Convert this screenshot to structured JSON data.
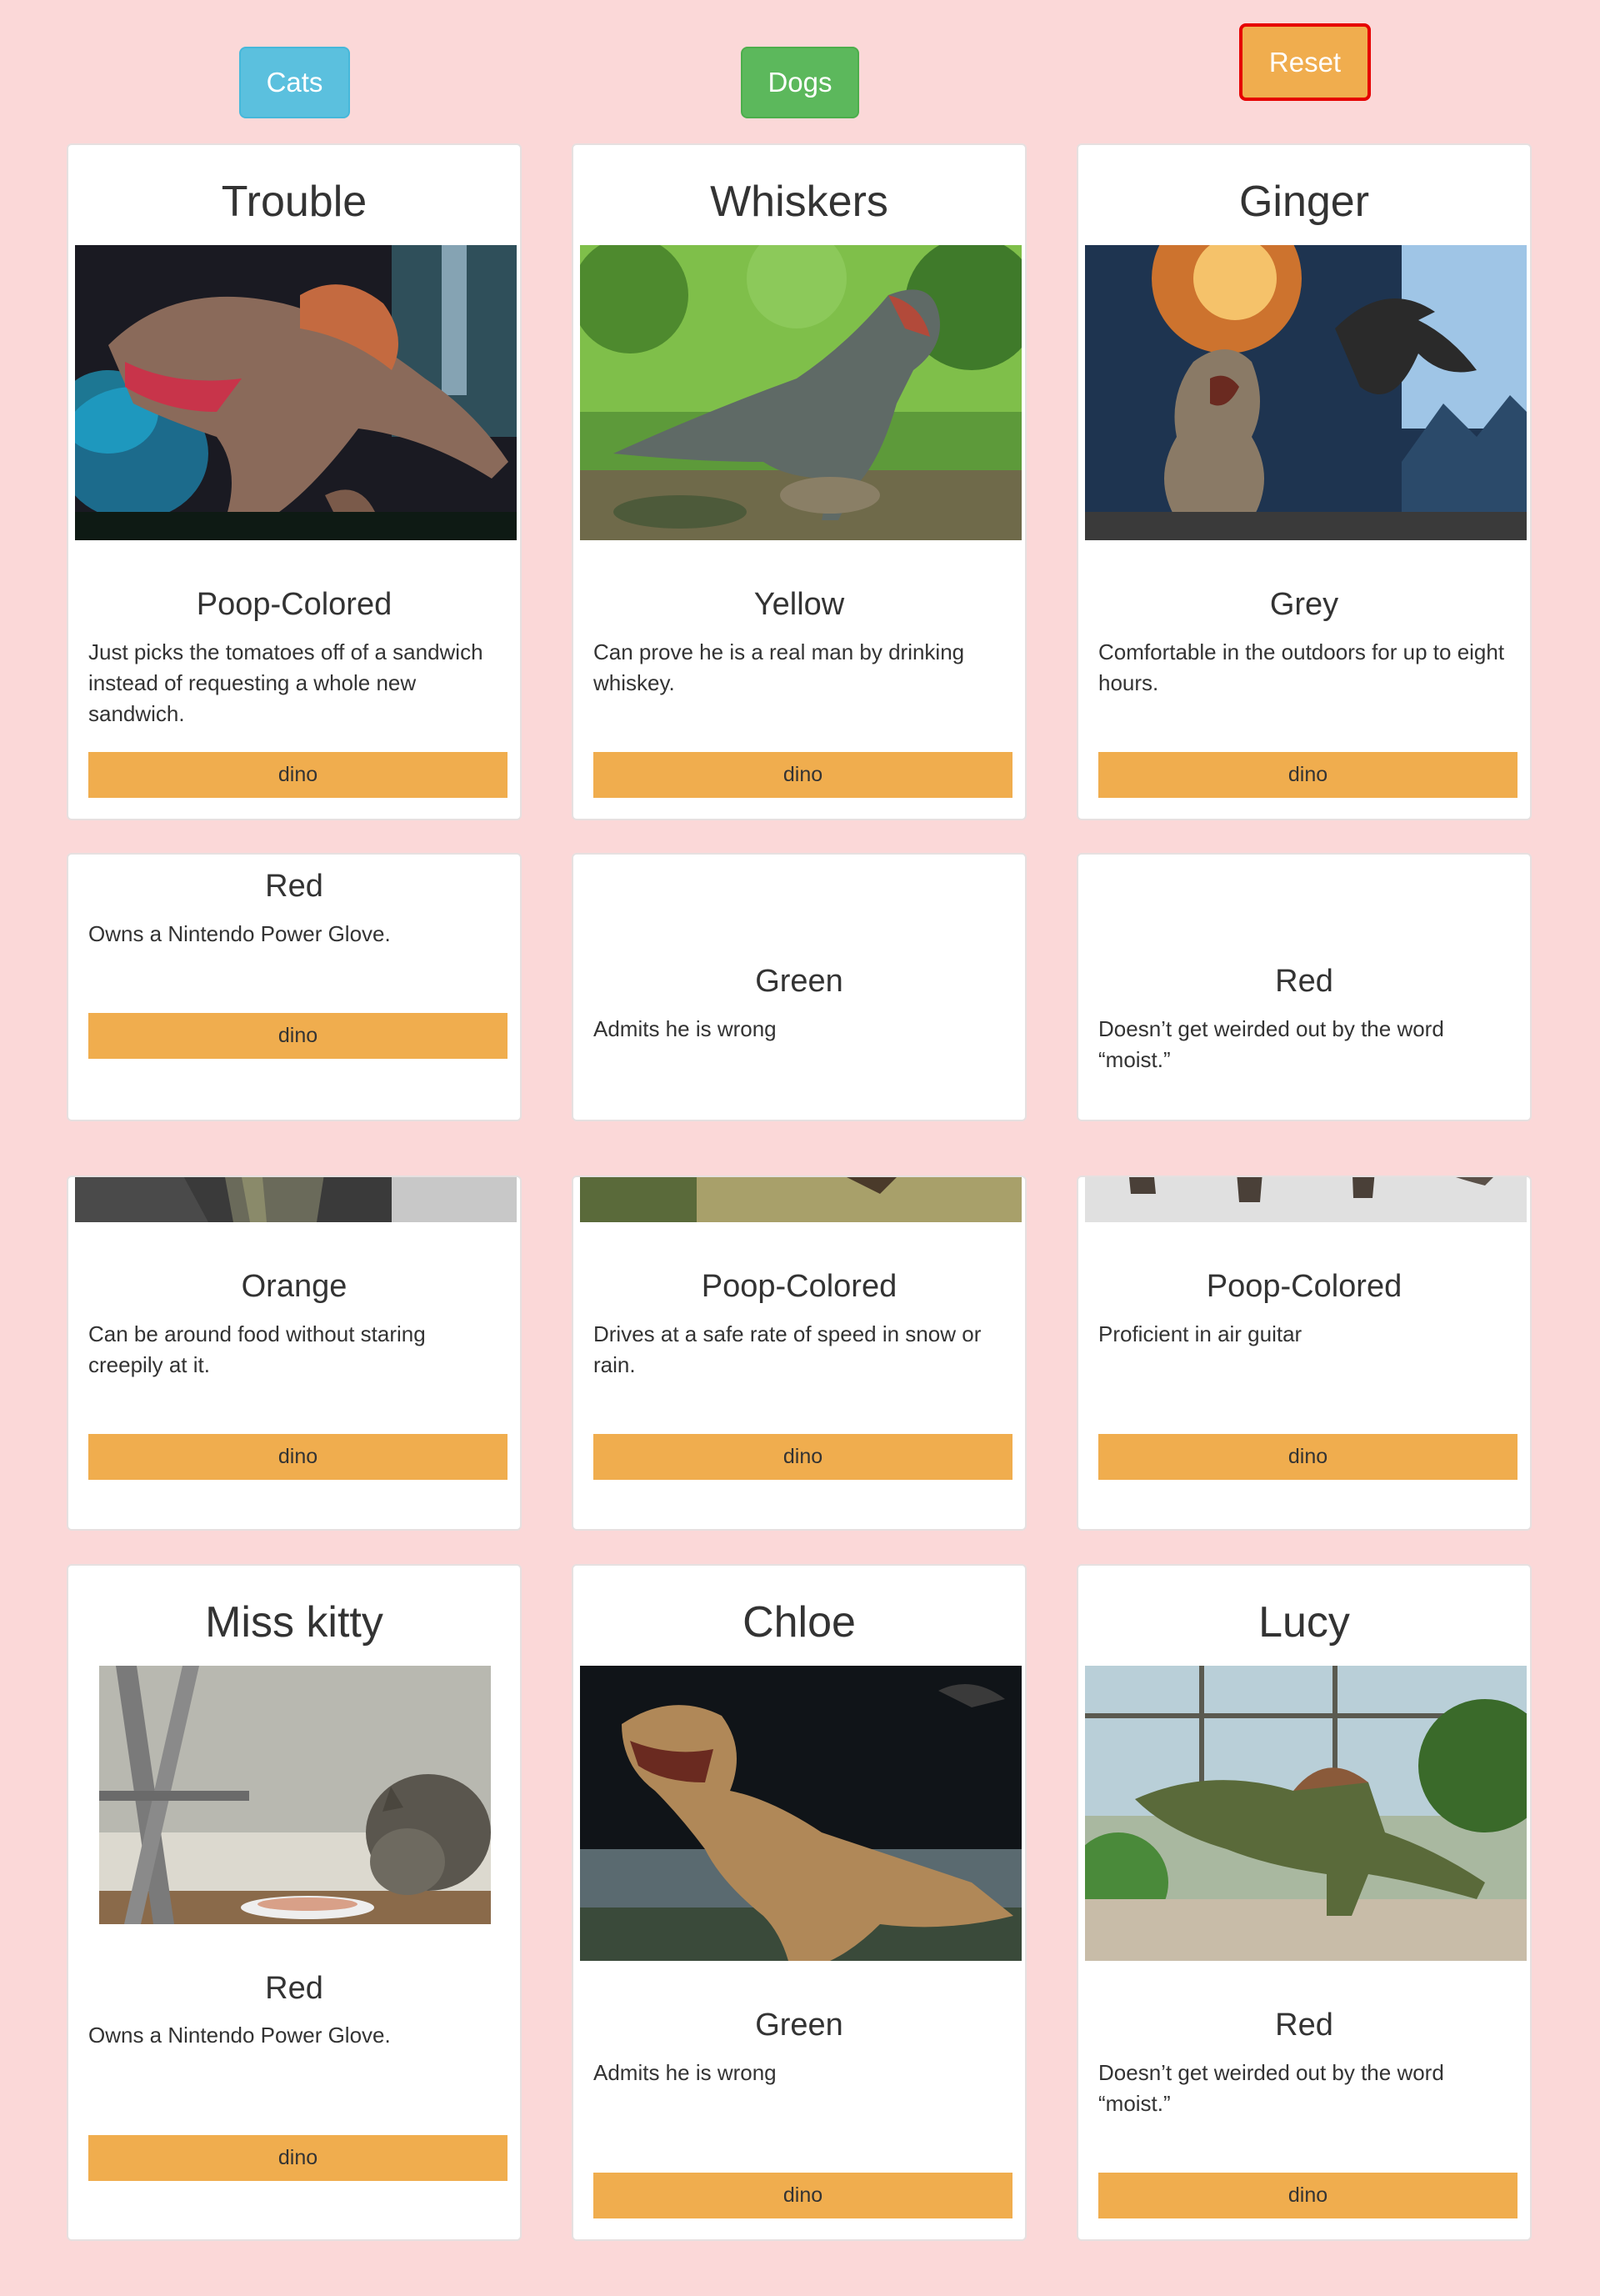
{
  "filters": {
    "cats_label": "Cats",
    "dogs_label": "Dogs",
    "reset_label": "Reset"
  },
  "colors": {
    "page_background": "#fbd8d8",
    "cats_button": "#5bc0de",
    "dogs_button": "#5cb85c",
    "reset_button": "#f0ad4e",
    "reset_border": "#e60000",
    "dino_button": "#f0ad4e"
  },
  "cards": [
    {
      "name": "Trouble",
      "color": "Poop-Colored",
      "description": "Just picks the tomatoes off of a sandwich instead of requesting a whole new sandwich.",
      "button": "dino",
      "image": "spinosaurus-photo"
    },
    {
      "name": "Whiskers",
      "color": "Yellow",
      "description": "Can prove he is a real man by drinking whiskey.",
      "button": "dino",
      "image": "t-rex-forest-photo"
    },
    {
      "name": "Ginger",
      "color": "Grey",
      "description": "Comfortable in the outdoors for up to eight hours.",
      "button": "dino",
      "image": "t-rex-pterosaur-photo"
    },
    {
      "name": "",
      "color": "Red",
      "description": "Owns a Nintendo Power Glove.",
      "button": "dino",
      "image": ""
    },
    {
      "name": "",
      "color": "Green",
      "description": "Admits he is wrong",
      "button": "dino",
      "image": ""
    },
    {
      "name": "",
      "color": "Red",
      "description": "Doesn’t get weirded out by the word “moist.”",
      "button": "dino",
      "image": ""
    },
    {
      "name": "",
      "color": "Orange",
      "description": "Can be around food without staring creepily at it.",
      "button": "dino",
      "image": "dino-rocks-photo"
    },
    {
      "name": "",
      "color": "Poop-Colored",
      "description": "Drives at a safe rate of speed in snow or rain.",
      "button": "dino",
      "image": "dino-grass-photo"
    },
    {
      "name": "",
      "color": "Poop-Colored",
      "description": "Proficient in air guitar",
      "button": "dino",
      "image": "dino-legs-photo"
    },
    {
      "name": "Miss kitty",
      "color": "Red",
      "description": "Owns a Nintendo Power Glove.",
      "button": "dino",
      "image": "cat-eating-photo"
    },
    {
      "name": "Chloe",
      "color": "Green",
      "description": "Admits he is wrong",
      "button": "dino",
      "image": "t-rex-museum-photo"
    },
    {
      "name": "Lucy",
      "color": "Red",
      "description": "Doesn’t get weirded out by the word “moist.”",
      "button": "dino",
      "image": "spinosaurus-diorama-photo"
    }
  ]
}
